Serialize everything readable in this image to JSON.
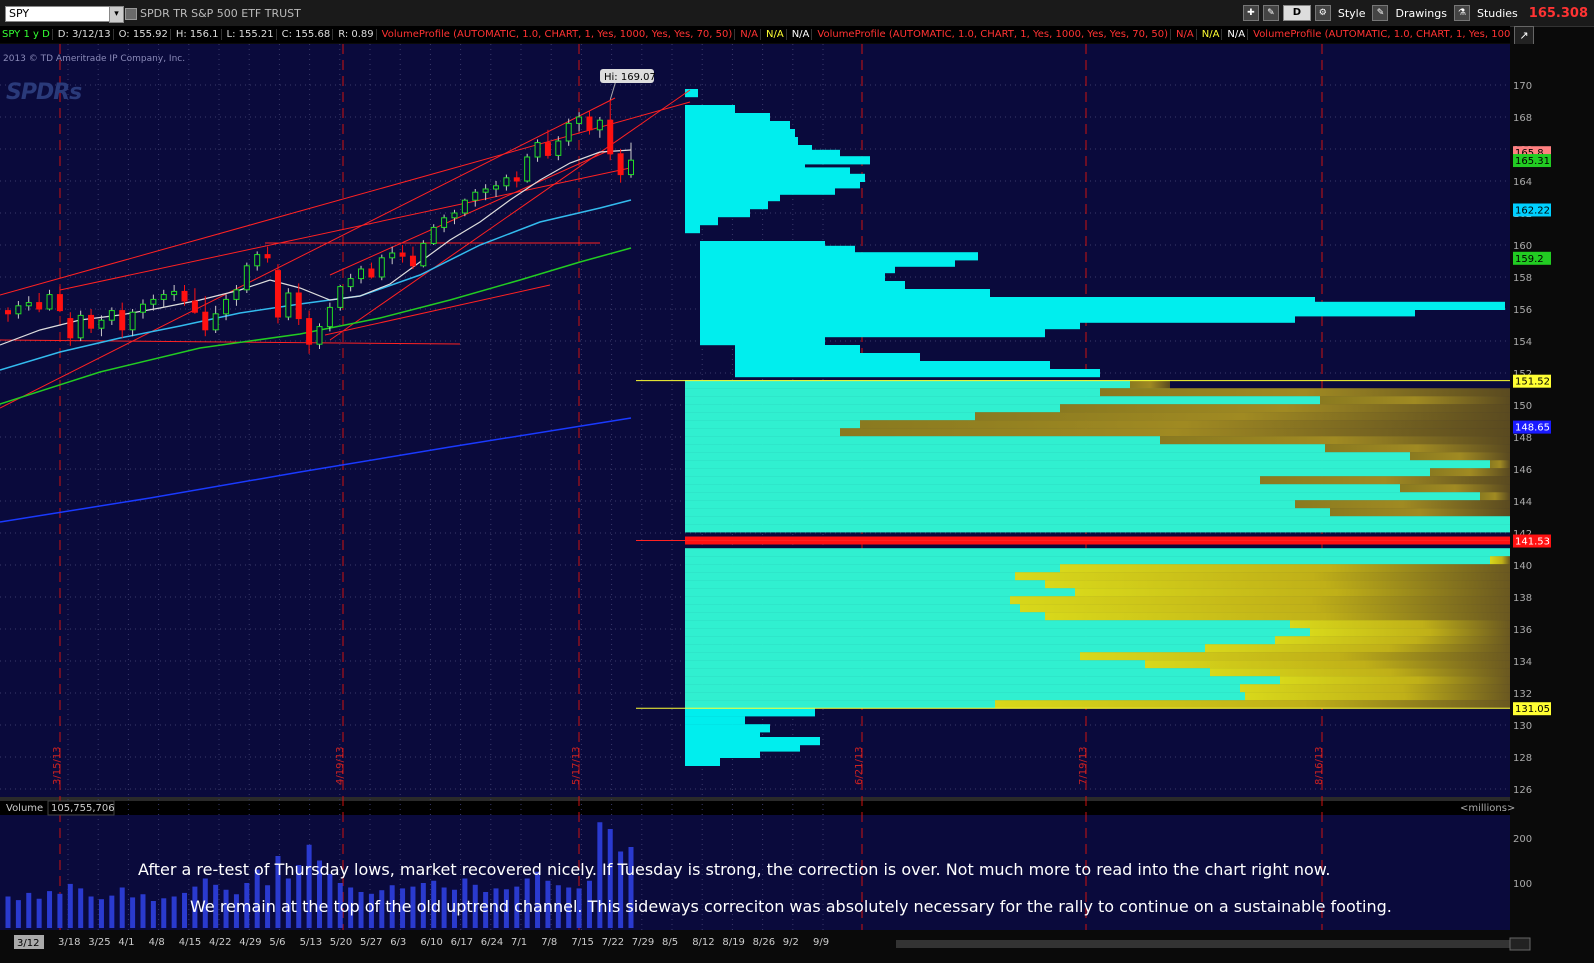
{
  "window": {
    "symbol": "SPY",
    "description": "SPDR TR S&P 500 ETF TRUST",
    "toolbar": {
      "d_button": "D",
      "style": "Style",
      "drawings": "Drawings",
      "studies": "Studies"
    },
    "last_price": "165.308"
  },
  "infobar": [
    {
      "text": "SPY 1 y D",
      "color": "#33ff33"
    },
    {
      "text": "D: 3/12/13",
      "color": "#dddddd"
    },
    {
      "text": "O: 155.92",
      "color": "#dddddd"
    },
    {
      "text": "H: 156.1",
      "color": "#dddddd"
    },
    {
      "text": "L: 155.21",
      "color": "#dddddd"
    },
    {
      "text": "C: 155.68",
      "color": "#dddddd"
    },
    {
      "text": "R: 0.89",
      "color": "#dddddd"
    },
    {
      "text": "VolumeProfile (AUTOMATIC, 1.0, CHART, 1, Yes, 1000, Yes, Yes, 70, 50)",
      "color": "#ff3333"
    },
    {
      "text": "N/A",
      "color": "#ff3333"
    },
    {
      "text": "N/A",
      "color": "#ffff33"
    },
    {
      "text": "N/A",
      "color": "#ffffff"
    },
    {
      "text": "VolumeProfile (AUTOMATIC, 1.0, CHART, 1, Yes, 1000, Yes, Yes, 70, 50)",
      "color": "#ff3333"
    },
    {
      "text": "N/A",
      "color": "#ff3333"
    },
    {
      "text": "N/A",
      "color": "#ffff33"
    },
    {
      "text": "N/A",
      "color": "#ffffff"
    },
    {
      "text": "VolumeProfile (AUTOMATIC, 1.0, CHART, 1, Yes, 1000, Yes, Yes, 70, 50) ...",
      "color": "#ff3333"
    }
  ],
  "copyright": "2013 © TD Ameritrade IP Company, Inc.",
  "logo": "SPDRs",
  "volume_label": "Volume",
  "volume_value": "105,755,706",
  "volume_units": "<millions>",
  "notes": [
    "After a re-test of Thursday lows, market recovered nicely. If Tuesday is strong, the correction is over. Not much more to read into the chart right now.",
    "We remain at the top of the old uptrend channel. This sideways correciton was absolutely necessary for the rally to continue on a sustainable footing."
  ],
  "colors": {
    "background": "#0a0a3c",
    "profile": "#00eeee",
    "value_area": "#c8c814",
    "poc": "#ff1111",
    "up": "#22cc22",
    "down": "#ff1111"
  },
  "chart_data": {
    "type": "candlestick",
    "ylim": [
      125,
      171
    ],
    "y_ticks": [
      126,
      128,
      130,
      132,
      134,
      136,
      138,
      140,
      142,
      144,
      146,
      148,
      150,
      152,
      154,
      156,
      158,
      160,
      162,
      164,
      166,
      168,
      170
    ],
    "x_date_labels": [
      "3/18",
      "3/25",
      "4/1",
      "4/8",
      "4/15",
      "4/22",
      "4/29",
      "5/6",
      "5/13",
      "5/20",
      "5/27",
      "6/3",
      "6/10",
      "6/17",
      "6/24",
      "7/1",
      "7/8",
      "7/15",
      "7/22",
      "7/29",
      "8/5",
      "8/12",
      "8/19",
      "8/26",
      "9/2",
      "9/9"
    ],
    "first_date_label": "3/12",
    "period_markers": [
      "3/15/13",
      "4/19/13",
      "5/17/13",
      "6/21/13",
      "7/19/13",
      "8/16/13"
    ],
    "candles": [
      [
        155.9,
        156.1,
        155.2,
        155.7
      ],
      [
        155.7,
        156.5,
        155.4,
        156.2
      ],
      [
        156.2,
        156.8,
        155.9,
        156.4
      ],
      [
        156.4,
        157.0,
        155.8,
        156.0
      ],
      [
        156.0,
        157.2,
        155.9,
        156.9
      ],
      [
        156.9,
        157.4,
        155.8,
        155.9
      ],
      [
        155.4,
        155.8,
        153.7,
        154.2
      ],
      [
        154.2,
        155.9,
        154.0,
        155.6
      ],
      [
        155.6,
        156.0,
        154.5,
        154.8
      ],
      [
        154.8,
        155.6,
        154.3,
        155.3
      ],
      [
        155.3,
        156.1,
        155.0,
        155.9
      ],
      [
        155.9,
        156.4,
        154.2,
        154.7
      ],
      [
        154.7,
        156.0,
        154.3,
        155.8
      ],
      [
        155.8,
        156.6,
        155.4,
        156.3
      ],
      [
        156.3,
        156.9,
        155.9,
        156.6
      ],
      [
        156.6,
        157.2,
        156.1,
        156.9
      ],
      [
        156.9,
        157.5,
        156.5,
        157.1
      ],
      [
        157.1,
        157.5,
        156.2,
        156.5
      ],
      [
        156.5,
        157.3,
        155.7,
        155.8
      ],
      [
        155.8,
        156.8,
        154.3,
        154.7
      ],
      [
        154.7,
        156.2,
        154.5,
        155.7
      ],
      [
        155.7,
        156.9,
        155.3,
        156.6
      ],
      [
        156.6,
        157.5,
        156.2,
        157.2
      ],
      [
        157.2,
        158.9,
        157.0,
        158.7
      ],
      [
        158.7,
        159.6,
        158.4,
        159.4
      ],
      [
        159.4,
        159.9,
        158.9,
        159.2
      ],
      [
        158.4,
        158.8,
        155.1,
        155.5
      ],
      [
        155.5,
        157.3,
        155.3,
        157.0
      ],
      [
        157.0,
        157.6,
        155.0,
        155.4
      ],
      [
        155.4,
        155.9,
        153.2,
        153.8
      ],
      [
        153.8,
        155.1,
        153.5,
        154.9
      ],
      [
        154.9,
        156.4,
        154.6,
        156.1
      ],
      [
        156.1,
        157.5,
        155.9,
        157.4
      ],
      [
        157.4,
        158.2,
        157.1,
        157.9
      ],
      [
        157.9,
        158.7,
        157.6,
        158.5
      ],
      [
        158.5,
        158.9,
        157.9,
        158.0
      ],
      [
        158.0,
        159.4,
        157.8,
        159.2
      ],
      [
        159.2,
        159.9,
        158.8,
        159.5
      ],
      [
        159.5,
        160.0,
        158.9,
        159.3
      ],
      [
        159.3,
        159.9,
        158.5,
        158.7
      ],
      [
        158.7,
        160.3,
        158.6,
        160.1
      ],
      [
        160.1,
        161.3,
        160.0,
        161.1
      ],
      [
        161.1,
        161.9,
        160.8,
        161.7
      ],
      [
        161.7,
        162.2,
        161.3,
        162.0
      ],
      [
        162.0,
        162.9,
        161.8,
        162.8
      ],
      [
        162.8,
        163.5,
        162.4,
        163.3
      ],
      [
        163.3,
        163.8,
        162.8,
        163.5
      ],
      [
        163.5,
        164.0,
        163.0,
        163.7
      ],
      [
        163.7,
        164.4,
        163.4,
        164.2
      ],
      [
        164.2,
        164.6,
        163.6,
        164.0
      ],
      [
        164.0,
        165.7,
        163.9,
        165.5
      ],
      [
        165.5,
        166.6,
        165.2,
        166.4
      ],
      [
        166.4,
        167.2,
        165.4,
        165.6
      ],
      [
        165.6,
        166.8,
        165.3,
        166.5
      ],
      [
        166.5,
        167.9,
        166.2,
        167.6
      ],
      [
        167.6,
        168.3,
        167.1,
        168.0
      ],
      [
        168.0,
        168.4,
        166.9,
        167.2
      ],
      [
        167.2,
        168.0,
        166.7,
        167.8
      ],
      [
        167.8,
        169.07,
        165.3,
        165.7
      ],
      [
        165.7,
        166.0,
        163.9,
        164.4
      ],
      [
        164.4,
        166.4,
        164.2,
        165.3
      ]
    ],
    "hi_label": "Hi: 169.07",
    "price_tags": [
      {
        "price": 165.8,
        "text": "165.8",
        "bg": "#ff8080",
        "fg": "#000"
      },
      {
        "price": 165.31,
        "text": "165.31",
        "bg": "#22cc22",
        "fg": "#000"
      },
      {
        "price": 162.22,
        "text": "162.22",
        "bg": "#00d0ff",
        "fg": "#000"
      },
      {
        "price": 159.2,
        "text": "159.2",
        "bg": "#22cc22",
        "fg": "#000"
      },
      {
        "price": 151.52,
        "text": "151.52",
        "bg": "#ffff33",
        "fg": "#000"
      },
      {
        "price": 148.65,
        "text": "148.65",
        "bg": "#1a1aff",
        "fg": "#fff"
      },
      {
        "price": 141.53,
        "text": "141.53",
        "bg": "#ff1111",
        "fg": "#fff"
      },
      {
        "price": 131.05,
        "text": "131.05",
        "bg": "#ffff33",
        "fg": "#000"
      }
    ],
    "value_area": {
      "high": 151.52,
      "low": 131.05,
      "poc": 141.53
    },
    "volume_ticks": [
      100,
      200
    ]
  }
}
